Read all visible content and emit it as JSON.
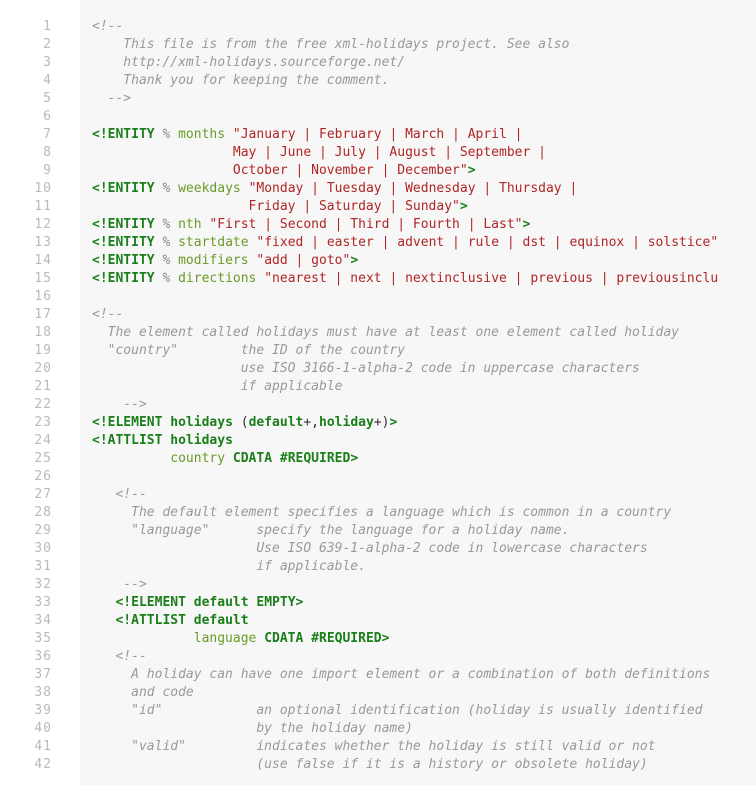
{
  "lines": [
    {
      "n": 1,
      "seg": [
        [
          "cm",
          "<!--"
        ]
      ]
    },
    {
      "n": 2,
      "seg": [
        [
          "cm",
          "    This file is from the free xml-holidays project. See also"
        ]
      ]
    },
    {
      "n": 3,
      "seg": [
        [
          "cm",
          "    http://xml-holidays.sourceforge.net/"
        ]
      ]
    },
    {
      "n": 4,
      "seg": [
        [
          "cm",
          "    Thank you for keeping the comment."
        ]
      ]
    },
    {
      "n": 5,
      "seg": [
        [
          "cm",
          "  -->"
        ]
      ]
    },
    {
      "n": 6,
      "seg": [
        [
          "pl",
          ""
        ]
      ]
    },
    {
      "n": 7,
      "seg": [
        [
          "kw",
          "<!ENTITY"
        ],
        [
          "pl",
          " "
        ],
        [
          "pc",
          "%"
        ],
        [
          "pl",
          " "
        ],
        [
          "attr",
          "months"
        ],
        [
          "pl",
          " "
        ],
        [
          "str",
          "\"January | February | March | April |"
        ]
      ]
    },
    {
      "n": 8,
      "seg": [
        [
          "str",
          "                  May | June | July | August | September |"
        ]
      ]
    },
    {
      "n": 9,
      "seg": [
        [
          "str",
          "                  October | November | December\""
        ],
        [
          "kw",
          ">"
        ]
      ]
    },
    {
      "n": 10,
      "seg": [
        [
          "kw",
          "<!ENTITY"
        ],
        [
          "pl",
          " "
        ],
        [
          "pc",
          "%"
        ],
        [
          "pl",
          " "
        ],
        [
          "attr",
          "weekdays"
        ],
        [
          "pl",
          " "
        ],
        [
          "str",
          "\"Monday | Tuesday | Wednesday | Thursday |"
        ]
      ]
    },
    {
      "n": 11,
      "seg": [
        [
          "str",
          "                    Friday | Saturday | Sunday\""
        ],
        [
          "kw",
          ">"
        ]
      ]
    },
    {
      "n": 12,
      "seg": [
        [
          "kw",
          "<!ENTITY"
        ],
        [
          "pl",
          " "
        ],
        [
          "pc",
          "%"
        ],
        [
          "pl",
          " "
        ],
        [
          "attr",
          "nth"
        ],
        [
          "pl",
          " "
        ],
        [
          "str",
          "\"First | Second | Third | Fourth | Last\""
        ],
        [
          "kw",
          ">"
        ]
      ]
    },
    {
      "n": 13,
      "seg": [
        [
          "kw",
          "<!ENTITY"
        ],
        [
          "pl",
          " "
        ],
        [
          "pc",
          "%"
        ],
        [
          "pl",
          " "
        ],
        [
          "attr",
          "startdate"
        ],
        [
          "pl",
          " "
        ],
        [
          "str",
          "\"fixed | easter | advent | rule | dst | equinox | solstice\""
        ]
      ]
    },
    {
      "n": 14,
      "seg": [
        [
          "kw",
          "<!ENTITY"
        ],
        [
          "pl",
          " "
        ],
        [
          "pc",
          "%"
        ],
        [
          "pl",
          " "
        ],
        [
          "attr",
          "modifiers"
        ],
        [
          "pl",
          " "
        ],
        [
          "str",
          "\"add | goto\""
        ],
        [
          "kw",
          ">"
        ]
      ]
    },
    {
      "n": 15,
      "seg": [
        [
          "kw",
          "<!ENTITY"
        ],
        [
          "pl",
          " "
        ],
        [
          "pc",
          "%"
        ],
        [
          "pl",
          " "
        ],
        [
          "attr",
          "directions"
        ],
        [
          "pl",
          " "
        ],
        [
          "str",
          "\"nearest | next | nextinclusive | previous | previousinclu"
        ]
      ]
    },
    {
      "n": 16,
      "seg": [
        [
          "pl",
          ""
        ]
      ]
    },
    {
      "n": 17,
      "seg": [
        [
          "cm",
          "<!--"
        ]
      ]
    },
    {
      "n": 18,
      "seg": [
        [
          "cm",
          "  The element called holidays must have at least one element called holiday"
        ]
      ]
    },
    {
      "n": 19,
      "seg": [
        [
          "cm",
          "  \"country\"        the ID of the country"
        ]
      ]
    },
    {
      "n": 20,
      "seg": [
        [
          "cm",
          "                   use ISO 3166-1-alpha-2 code in uppercase characters"
        ]
      ]
    },
    {
      "n": 21,
      "seg": [
        [
          "cm",
          "                   if applicable"
        ]
      ]
    },
    {
      "n": 22,
      "seg": [
        [
          "cm",
          "    -->"
        ]
      ]
    },
    {
      "n": 23,
      "seg": [
        [
          "kw",
          "<!ELEMENT"
        ],
        [
          "pl",
          " "
        ],
        [
          "nm",
          "holidays"
        ],
        [
          "pl",
          " ("
        ],
        [
          "nm",
          "default"
        ],
        [
          "pl",
          "+,"
        ],
        [
          "nm",
          "holiday"
        ],
        [
          "pl",
          "+)"
        ],
        [
          "kw",
          ">"
        ]
      ]
    },
    {
      "n": 24,
      "seg": [
        [
          "kw",
          "<!ATTLIST"
        ],
        [
          "pl",
          " "
        ],
        [
          "nm",
          "holidays"
        ]
      ]
    },
    {
      "n": 25,
      "seg": [
        [
          "pl",
          "          "
        ],
        [
          "attr",
          "country"
        ],
        [
          "pl",
          " "
        ],
        [
          "typ",
          "CDATA"
        ],
        [
          "pl",
          " "
        ],
        [
          "typ",
          "#REQUIRED"
        ],
        [
          "kw",
          ">"
        ]
      ]
    },
    {
      "n": 26,
      "seg": [
        [
          "pl",
          ""
        ]
      ]
    },
    {
      "n": 27,
      "seg": [
        [
          "cm",
          "   <!--"
        ]
      ]
    },
    {
      "n": 28,
      "seg": [
        [
          "cm",
          "     The default element specifies a language which is common in a country"
        ]
      ]
    },
    {
      "n": 29,
      "seg": [
        [
          "cm",
          "     \"language\"      specify the language for a holiday name."
        ]
      ]
    },
    {
      "n": 30,
      "seg": [
        [
          "cm",
          "                     Use ISO 639-1-alpha-2 code in lowercase characters"
        ]
      ]
    },
    {
      "n": 31,
      "seg": [
        [
          "cm",
          "                     if applicable."
        ]
      ]
    },
    {
      "n": 32,
      "seg": [
        [
          "cm",
          "    -->"
        ]
      ]
    },
    {
      "n": 33,
      "seg": [
        [
          "pl",
          "   "
        ],
        [
          "kw",
          "<!ELEMENT"
        ],
        [
          "pl",
          " "
        ],
        [
          "nm",
          "default"
        ],
        [
          "pl",
          " "
        ],
        [
          "typ",
          "EMPTY"
        ],
        [
          "kw",
          ">"
        ]
      ]
    },
    {
      "n": 34,
      "seg": [
        [
          "pl",
          "   "
        ],
        [
          "kw",
          "<!ATTLIST"
        ],
        [
          "pl",
          " "
        ],
        [
          "nm",
          "default"
        ]
      ]
    },
    {
      "n": 35,
      "seg": [
        [
          "pl",
          "             "
        ],
        [
          "attr",
          "language"
        ],
        [
          "pl",
          " "
        ],
        [
          "typ",
          "CDATA"
        ],
        [
          "pl",
          " "
        ],
        [
          "typ",
          "#REQUIRED"
        ],
        [
          "kw",
          ">"
        ]
      ]
    },
    {
      "n": 36,
      "seg": [
        [
          "cm",
          "   <!--"
        ]
      ]
    },
    {
      "n": 37,
      "seg": [
        [
          "cm",
          "     A holiday can have one import element or a combination of both definitions"
        ]
      ]
    },
    {
      "n": 38,
      "seg": [
        [
          "cm",
          "     and code"
        ]
      ]
    },
    {
      "n": 39,
      "seg": [
        [
          "cm",
          "     \"id\"            an optional identification (holiday is usually identified"
        ]
      ]
    },
    {
      "n": 40,
      "seg": [
        [
          "cm",
          "                     by the holiday name)"
        ]
      ]
    },
    {
      "n": 41,
      "seg": [
        [
          "cm",
          "     \"valid\"         indicates whether the holiday is still valid or not"
        ]
      ]
    },
    {
      "n": 42,
      "seg": [
        [
          "cm",
          "                     (use false if it is a history or obsolete holiday)"
        ]
      ]
    }
  ]
}
